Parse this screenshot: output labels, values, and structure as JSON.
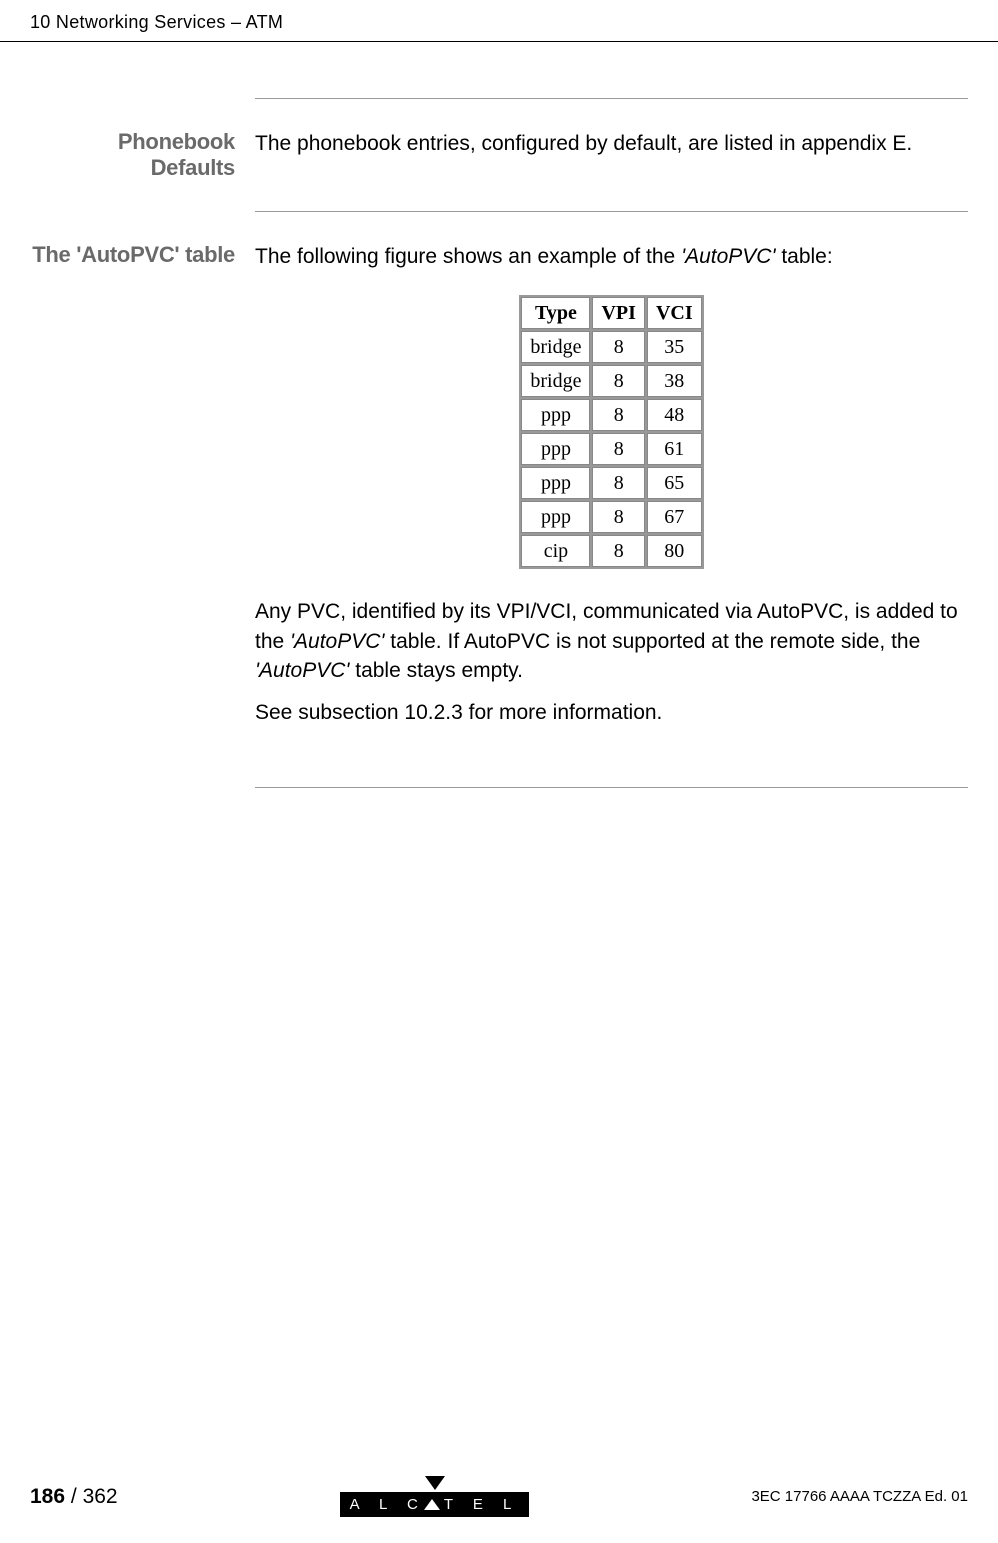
{
  "header": {
    "title": "10 Networking Services – ATM"
  },
  "sections": {
    "phonebook": {
      "heading": "Phonebook Defaults",
      "body": "The phonebook entries, configured by default, are listed in appendix E."
    },
    "autopvc": {
      "heading": "The 'AutoPVC' table",
      "intro_prefix": "The following figure shows an example of the ",
      "intro_italic": "'AutoPVC'",
      "intro_suffix": " table:",
      "table": {
        "headers": [
          "Type",
          "VPI",
          "VCI"
        ],
        "rows": [
          [
            "bridge",
            "8",
            "35"
          ],
          [
            "bridge",
            "8",
            "38"
          ],
          [
            "ppp",
            "8",
            "48"
          ],
          [
            "ppp",
            "8",
            "61"
          ],
          [
            "ppp",
            "8",
            "65"
          ],
          [
            "ppp",
            "8",
            "67"
          ],
          [
            "cip",
            "8",
            "80"
          ]
        ]
      },
      "para2_a": "Any PVC, identified by its VPI/VCI, communicated via AutoPVC, is added to the ",
      "para2_i1": "'AutoPVC'",
      "para2_b": " table. If AutoPVC is not supported at the remote side, the ",
      "para2_i2": "'AutoPVC'",
      "para2_c": " table stays empty.",
      "para3": "See subsection 10.2.3 for more information."
    }
  },
  "footer": {
    "page_current": "186",
    "page_sep": " / ",
    "page_total": "362",
    "logo_text_a": "A L C",
    "logo_text_b": "T E L",
    "doc_ref": "3EC 17766 AAAA TCZZA Ed. 01"
  }
}
